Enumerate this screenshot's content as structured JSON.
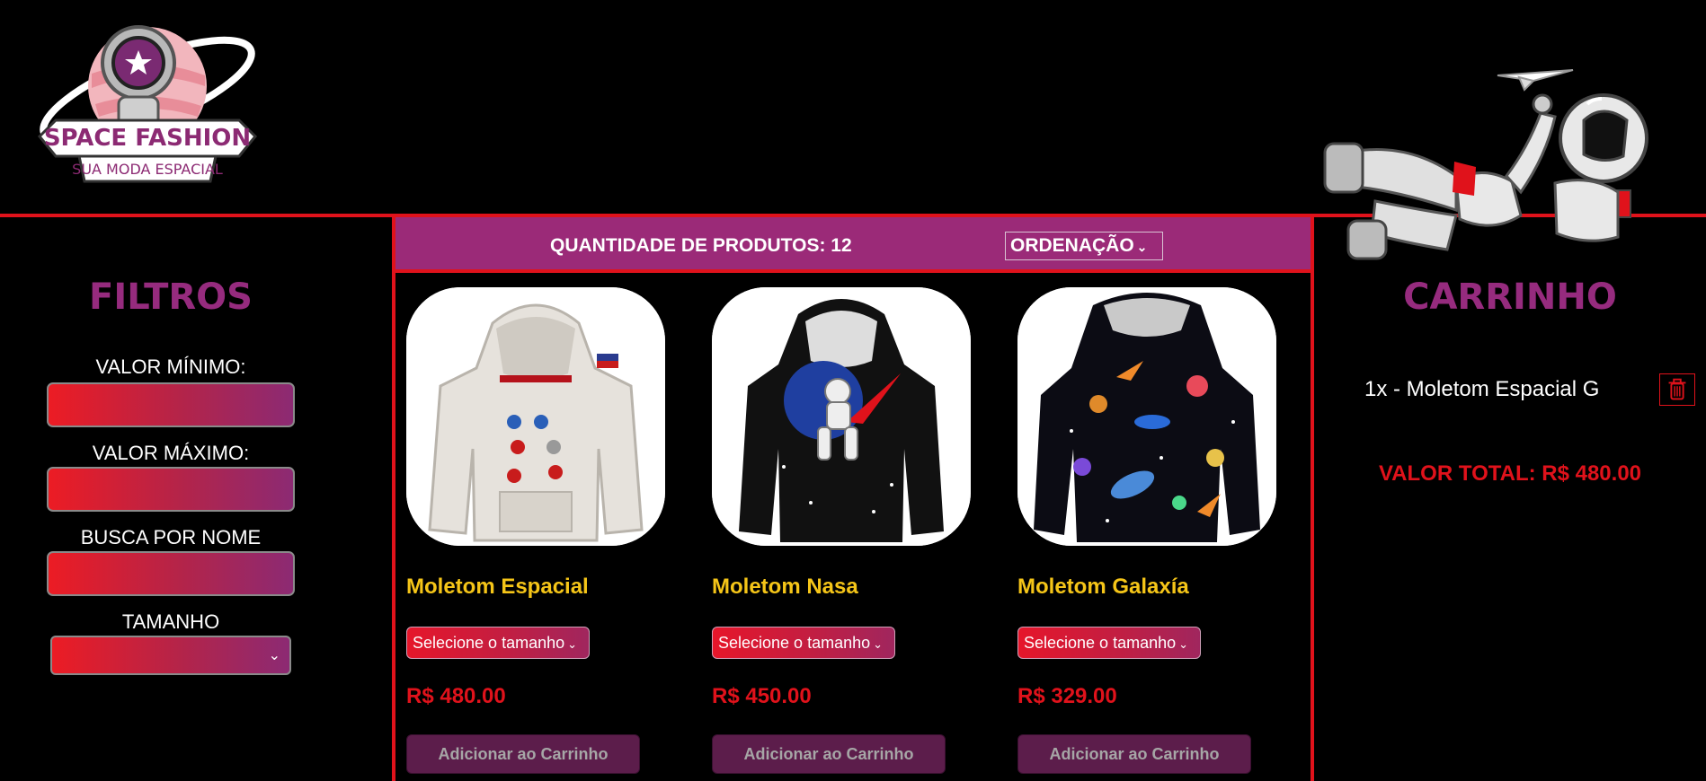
{
  "brand": {
    "name": "SPACE FASHION",
    "tagline": "SUA MODA ESPACIAL"
  },
  "colors": {
    "background": "#000000",
    "accent_red": "#e0121b",
    "purple": "#9b2a78",
    "title_purple": "#962b7e",
    "product_name": "#f5c518"
  },
  "filters": {
    "title": "FILTROS",
    "min_value_label": "VALOR MÍNIMO:",
    "min_value": "",
    "max_value_label": "VALOR MÁXIMO:",
    "max_value": "",
    "name_search_label": "BUSCA POR NOME",
    "name_search": "",
    "size_label": "TAMANHO",
    "size_selected": "",
    "size_icon": "chevron-down-icon"
  },
  "products_bar": {
    "quantity_text": "QUANTIDADE DE PRODUTOS: 12",
    "order_label": "ORDENAÇÃO"
  },
  "products": [
    {
      "name": "Moletom Espacial",
      "size_placeholder": "Selecione o tamanho",
      "price": "R$ 480.00",
      "add_label": "Adicionar ao Carrinho",
      "image": "white-astronaut-suit-hoodie"
    },
    {
      "name": "Moletom Nasa",
      "size_placeholder": "Selecione o tamanho",
      "price": "R$ 450.00",
      "add_label": "Adicionar ao Carrinho",
      "image": "black-nasa-astronaut-hoodie"
    },
    {
      "name": "Moletom Galaxía",
      "size_placeholder": "Selecione o tamanho",
      "price": "R$ 329.00",
      "add_label": "Adicionar ao Carrinho",
      "image": "black-galaxy-planets-hoodie"
    }
  ],
  "cart": {
    "title": "CARRINHO",
    "items": [
      {
        "text": "1x - Moletom Espacial G",
        "remove_icon": "trash-icon"
      }
    ],
    "total": "VALOR TOTAL: R$ 480.00"
  }
}
